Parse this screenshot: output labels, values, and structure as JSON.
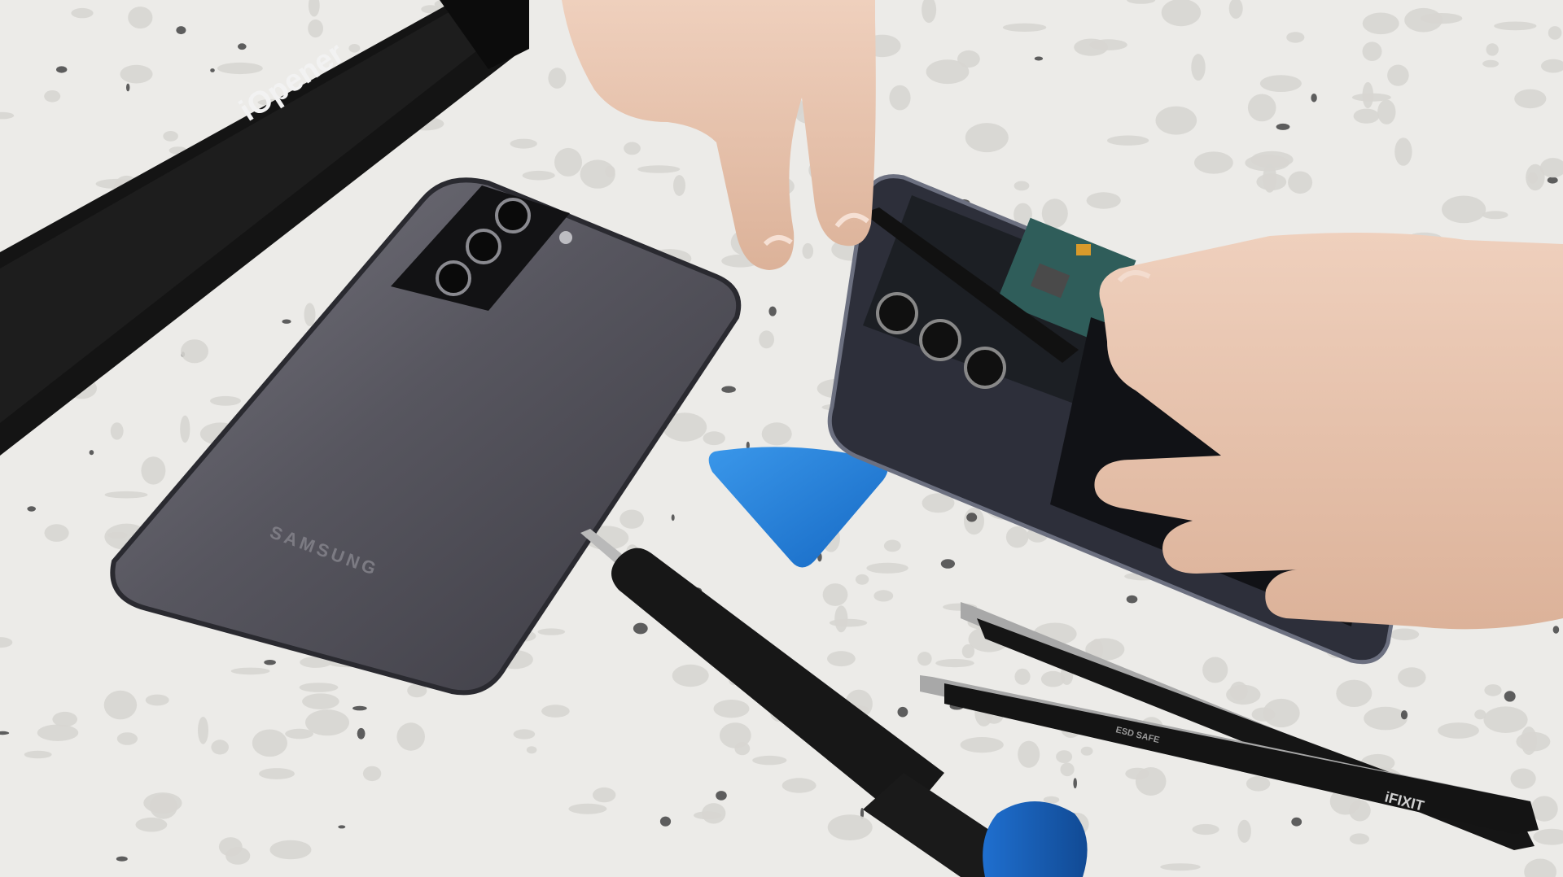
{
  "scene": {
    "description_colors": {
      "surface": "#ecebe8",
      "speckle_light": "#d8d7d3",
      "speckle_dark": "#3a3a3a",
      "phone_back": "#55545e",
      "pick_blue": "#1e7fd6",
      "driver_cap_blue": "#1b63b8",
      "tool_black": "#161616",
      "skin": "#e7c3ad"
    }
  },
  "labels": {
    "iopener_text": "iOpener",
    "samsung_text": "SAMSUNG",
    "ifixit_text": "iFIXIT",
    "esd_text": "ESD SAFE"
  }
}
